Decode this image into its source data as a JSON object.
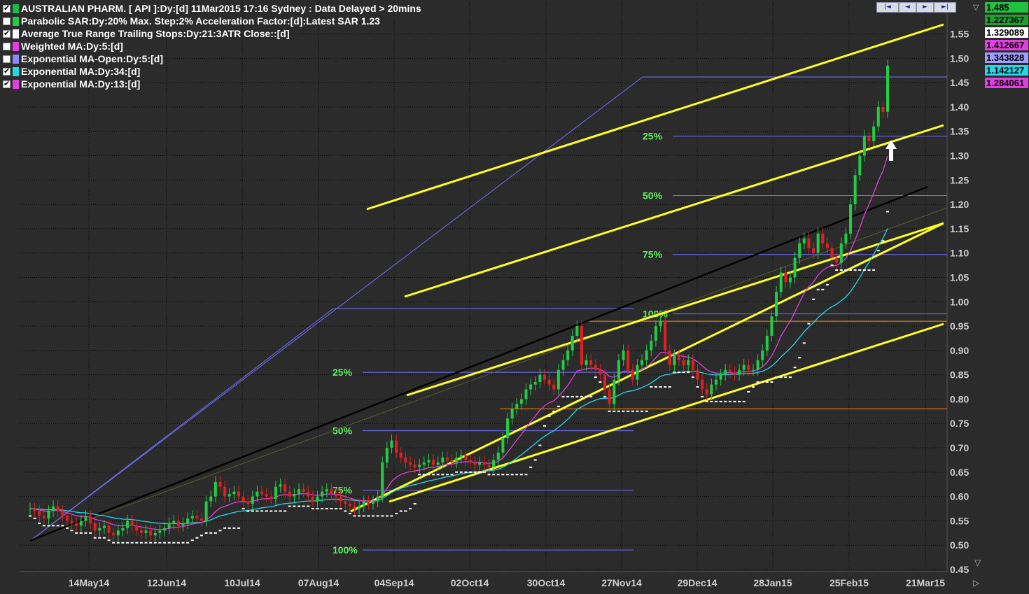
{
  "header": {
    "indicators": [
      {
        "label": "AUSTRALIAN PHARM. [ API ]:Dy:[d]  11Mar2015 17:16 Sydney : Data Delayed > 20mins",
        "checked": true,
        "color": "#1db84a"
      },
      {
        "label": "Parabolic SAR:Dy:20% Max. Step:2% Acceleration Factor:[d]:Latest SAR 1.23",
        "checked": false,
        "color": "#22cc44"
      },
      {
        "label": "Average True Range Trailing Stops:Dy:21:3ATR Close::[d]",
        "checked": true,
        "color": "#ffffff"
      },
      {
        "label": "Weighted MA:Dy:5:[d]",
        "checked": false,
        "color": "#e040e0"
      },
      {
        "label": "Exponential MA-Open:Dy:5:[d]",
        "checked": false,
        "color": "#8a8aff"
      },
      {
        "label": "Exponential MA:Dy:34:[d]",
        "checked": true,
        "color": "#22d8e8"
      },
      {
        "label": "Exponential MA:Dy:13:[d]",
        "checked": true,
        "color": "#e040e0"
      }
    ]
  },
  "nav": {
    "first": "|◄",
    "prev": "◄",
    "next": "►",
    "last": "►|"
  },
  "badges": [
    {
      "value": "1.485",
      "bg": "#22c040",
      "fg": "#000000"
    },
    {
      "value": "1.227367",
      "bg": "#1fa030",
      "fg": "#000000"
    },
    {
      "value": "1.329089",
      "bg": "#ffffff",
      "fg": "#000000"
    },
    {
      "value": "1.412667",
      "bg": "#e040e0",
      "fg": "#000000"
    },
    {
      "value": "1.343828",
      "bg": "#9f9fff",
      "fg": "#000000"
    },
    {
      "value": "1.142127",
      "bg": "#22d8e8",
      "fg": "#000000"
    },
    {
      "value": "1.284061",
      "bg": "#e040e0",
      "fg": "#000000"
    }
  ],
  "chart_data": {
    "type": "candlestick",
    "yticks": [
      "1.55",
      "1.50",
      "1.45",
      "1.40",
      "1.35",
      "1.30",
      "1.25",
      "1.20",
      "1.15",
      "1.10",
      "1.05",
      "1.00",
      "0.95",
      "0.90",
      "0.85",
      "0.80",
      "0.75",
      "0.70",
      "0.65",
      "0.60",
      "0.55",
      "0.50",
      "0.45"
    ],
    "ylim": [
      0.43,
      1.58
    ],
    "xticks": [
      "14May14",
      "12Jun14",
      "10Jul14",
      "07Aug14",
      "04Sep14",
      "02Oct14",
      "30Oct14",
      "27Nov14",
      "29Dec14",
      "28Jan15",
      "25Feb15",
      "21Mar15"
    ],
    "grid": true,
    "fib_levels": [
      {
        "label": "25%",
        "y": 0.855
      },
      {
        "label": "50%",
        "y": 0.735
      },
      {
        "label": "75%",
        "y": 0.613
      },
      {
        "label": "100%",
        "y": 0.49
      },
      {
        "label": "25%",
        "y": 1.34
      },
      {
        "label": "50%",
        "y": 1.218
      },
      {
        "label": "75%",
        "y": 1.097
      },
      {
        "label": "100%",
        "y": 0.975
      }
    ],
    "closes": [
      0.575,
      0.57,
      0.56,
      0.555,
      0.57,
      0.58,
      0.57,
      0.56,
      0.55,
      0.545,
      0.54,
      0.55,
      0.56,
      0.545,
      0.53,
      0.535,
      0.54,
      0.525,
      0.52,
      0.53,
      0.535,
      0.55,
      0.54,
      0.53,
      0.525,
      0.53,
      0.52,
      0.525,
      0.53,
      0.535,
      0.545,
      0.55,
      0.54,
      0.545,
      0.555,
      0.56,
      0.555,
      0.55,
      0.59,
      0.6,
      0.63,
      0.62,
      0.6,
      0.605,
      0.61,
      0.6,
      0.59,
      0.585,
      0.6,
      0.61,
      0.605,
      0.6,
      0.595,
      0.62,
      0.625,
      0.61,
      0.6,
      0.605,
      0.615,
      0.61,
      0.6,
      0.59,
      0.6,
      0.61,
      0.615,
      0.605,
      0.6,
      0.59,
      0.585,
      0.58,
      0.575,
      0.58,
      0.59,
      0.585,
      0.59,
      0.6,
      0.67,
      0.7,
      0.715,
      0.69,
      0.68,
      0.67,
      0.665,
      0.66,
      0.665,
      0.67,
      0.675,
      0.665,
      0.67,
      0.68,
      0.675,
      0.67,
      0.68,
      0.685,
      0.675,
      0.67,
      0.665,
      0.67,
      0.665,
      0.66,
      0.675,
      0.69,
      0.72,
      0.76,
      0.78,
      0.79,
      0.8,
      0.82,
      0.83,
      0.835,
      0.85,
      0.84,
      0.83,
      0.82,
      0.86,
      0.88,
      0.9,
      0.93,
      0.95,
      0.87,
      0.88,
      0.87,
      0.86,
      0.85,
      0.82,
      0.79,
      0.84,
      0.88,
      0.9,
      0.86,
      0.84,
      0.87,
      0.88,
      0.9,
      0.92,
      0.95,
      0.96,
      0.9,
      0.87,
      0.89,
      0.88,
      0.87,
      0.88,
      0.86,
      0.84,
      0.82,
      0.81,
      0.83,
      0.84,
      0.85,
      0.86,
      0.855,
      0.85,
      0.86,
      0.87,
      0.86,
      0.86,
      0.88,
      0.9,
      0.93,
      0.97,
      1.02,
      1.06,
      1.04,
      1.05,
      1.09,
      1.12,
      1.13,
      1.11,
      1.1,
      1.14,
      1.12,
      1.11,
      1.09,
      1.08,
      1.12,
      1.14,
      1.2,
      1.26,
      1.3,
      1.34,
      1.33,
      1.36,
      1.4,
      1.39,
      1.485
    ],
    "ema13_last": 1.284061,
    "ema34_last": 1.142127,
    "atr_stop_last": 1.329089
  }
}
